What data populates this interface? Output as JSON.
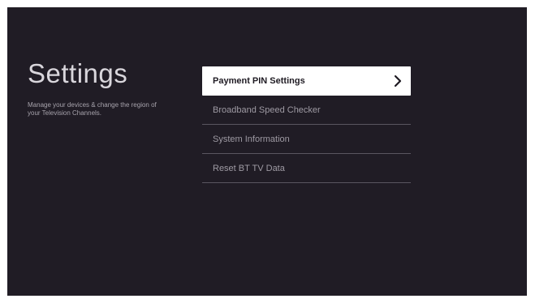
{
  "page": {
    "title": "Settings",
    "description": "Manage your devices & change the region of your Television Channels."
  },
  "menu": {
    "items": [
      {
        "label": "Payment PIN Settings",
        "selected": true,
        "icon": "chevron-right-icon"
      },
      {
        "label": "Broadband Speed Checker",
        "selected": false
      },
      {
        "label": "System Information",
        "selected": false
      },
      {
        "label": "Reset BT TV Data",
        "selected": false
      }
    ]
  },
  "colors": {
    "background": "#201c25",
    "selected_background": "#ffffff",
    "text": "#9e9aa3",
    "selected_text": "#1e1a22",
    "divider": "#5a5660"
  }
}
